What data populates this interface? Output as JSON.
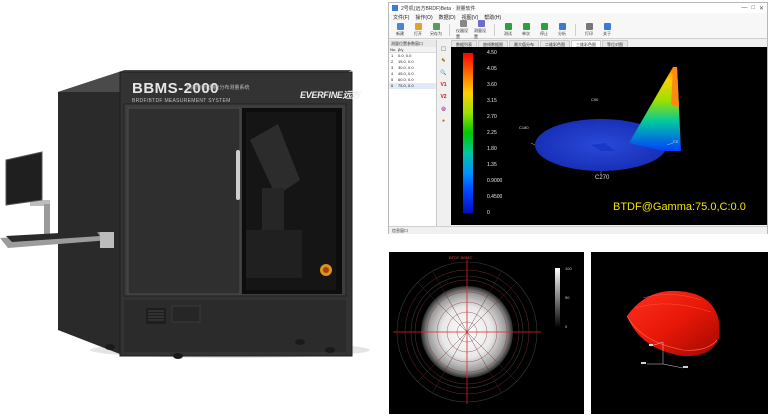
{
  "machine": {
    "model": "BBMS-2000",
    "subtitle_cn": "双向散射(透射)分布测量系统",
    "subtitle_en": "BRDF/BTDF MEASUREMENT SYSTEM",
    "brand": "EVERFINE远方"
  },
  "software": {
    "title": "2号机(远方BRDF)Beta · 测量软件",
    "window_controls": [
      "—",
      "□",
      "✕"
    ],
    "menu": [
      "文件(F)",
      "操作(O)",
      "数据(D)",
      "视图(V)",
      "帮助(H)"
    ],
    "toolbar": [
      {
        "label": "新建",
        "color": "#4a86d8"
      },
      {
        "label": "打开",
        "color": "#e0a030"
      },
      {
        "label": "另存为",
        "color": "#5a9a5a"
      },
      {
        "label": "仪器设置",
        "color": "#888888"
      },
      {
        "label": "测量设置",
        "color": "#6b6bd0"
      },
      {
        "label": "测试",
        "color": "#2e9e3e"
      },
      {
        "label": "单次",
        "color": "#2e9e3e"
      },
      {
        "label": "停止",
        "color": "#2e9e3e"
      },
      {
        "label": "分析",
        "color": "#3a7bd5"
      },
      {
        "label": "打印",
        "color": "#777777"
      },
      {
        "label": "关于",
        "color": "#3a7bd5"
      }
    ],
    "left_pane": {
      "title": "测量位置参数窗口",
      "header": [
        "No.",
        "β/γ"
      ],
      "rows": [
        [
          "1",
          "0.0, 0.0"
        ],
        [
          "2",
          "15.0, 0.0"
        ],
        [
          "3",
          "30.0, 0.0"
        ],
        [
          "4",
          "45.0, 0.0"
        ],
        [
          "5",
          "60.0, 0.0"
        ],
        [
          "6",
          "75.0, 0.0"
        ]
      ],
      "selected_row": 5
    },
    "side_tools": [
      {
        "glyph": "⬚",
        "color": "#555555"
      },
      {
        "glyph": "✎",
        "color": "#8a6d00"
      },
      {
        "glyph": "🔍",
        "color": "#555555"
      },
      {
        "glyph": "V1",
        "color": "#d01010"
      },
      {
        "glyph": "V2",
        "color": "#d01010"
      },
      {
        "glyph": "◎",
        "color": "#8a1a8a"
      },
      {
        "glyph": "●",
        "color": "#d06000"
      }
    ],
    "tabs": [
      "数据列表",
      "曲线数据图",
      "最大值分布",
      "二维彩色图",
      "三维彩色图",
      "等位对图"
    ],
    "active_tab": 4,
    "colorbar": {
      "labels": [
        "4.50",
        "4.05",
        "3.60",
        "3.15",
        "2.70",
        "2.25",
        "1.80",
        "1.35",
        "0.9000",
        "0.4500",
        "0"
      ],
      "colors": [
        "#ff0000",
        "#ff6a00",
        "#ffd000",
        "#9be000",
        "#00c800",
        "#00c8a0",
        "#0090ff",
        "#0040ff",
        "#0010c0"
      ]
    },
    "axis_labels": {
      "c0": "C0",
      "c90": "C90",
      "c180": "C180",
      "c270": "C270"
    },
    "plot_caption": "BTDF@Gamma:75.0,C:0.0",
    "status": "信息窗口"
  },
  "grey_image": {
    "title": "BTDF BBMS",
    "scale_ticks": [
      "100",
      "50",
      "0"
    ]
  }
}
